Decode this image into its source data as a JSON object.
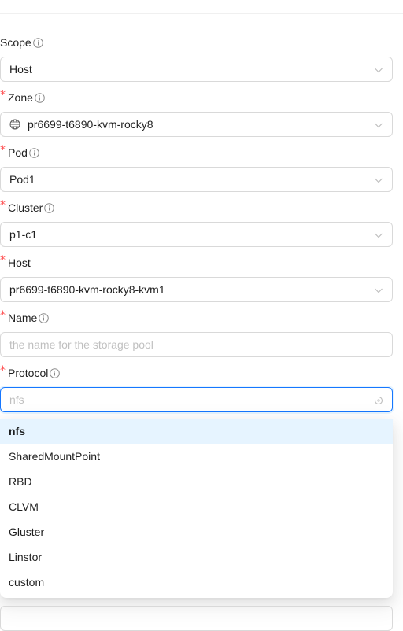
{
  "form": {
    "scope": {
      "label": "Scope",
      "value": "Host",
      "required": false
    },
    "zone": {
      "label": "Zone",
      "value": "pr6699-t6890-kvm-rocky8",
      "required": true
    },
    "pod": {
      "label": "Pod",
      "value": "Pod1",
      "required": true
    },
    "cluster": {
      "label": "Cluster",
      "value": "p1-c1",
      "required": true
    },
    "host": {
      "label": "Host",
      "value": "pr6699-t6890-kvm-rocky8-kvm1",
      "required": true
    },
    "name": {
      "label": "Name",
      "value": "",
      "placeholder": "the name for the storage pool",
      "required": true
    },
    "protocol": {
      "label": "Protocol",
      "value": "nfs",
      "required": true
    }
  },
  "required_mark": "*",
  "protocol_options": [
    "nfs",
    "SharedMountPoint",
    "RBD",
    "CLVM",
    "Gluster",
    "Linstor",
    "custom"
  ],
  "active_option_index": 0,
  "colors": {
    "required": "#ff4d4f",
    "focus_border": "#1677ff",
    "active_option_bg": "#e6f4ff",
    "border": "#d9d9d9"
  },
  "icons": [
    "info-icon",
    "chevron-down-icon",
    "globe-icon",
    "loading-icon"
  ]
}
